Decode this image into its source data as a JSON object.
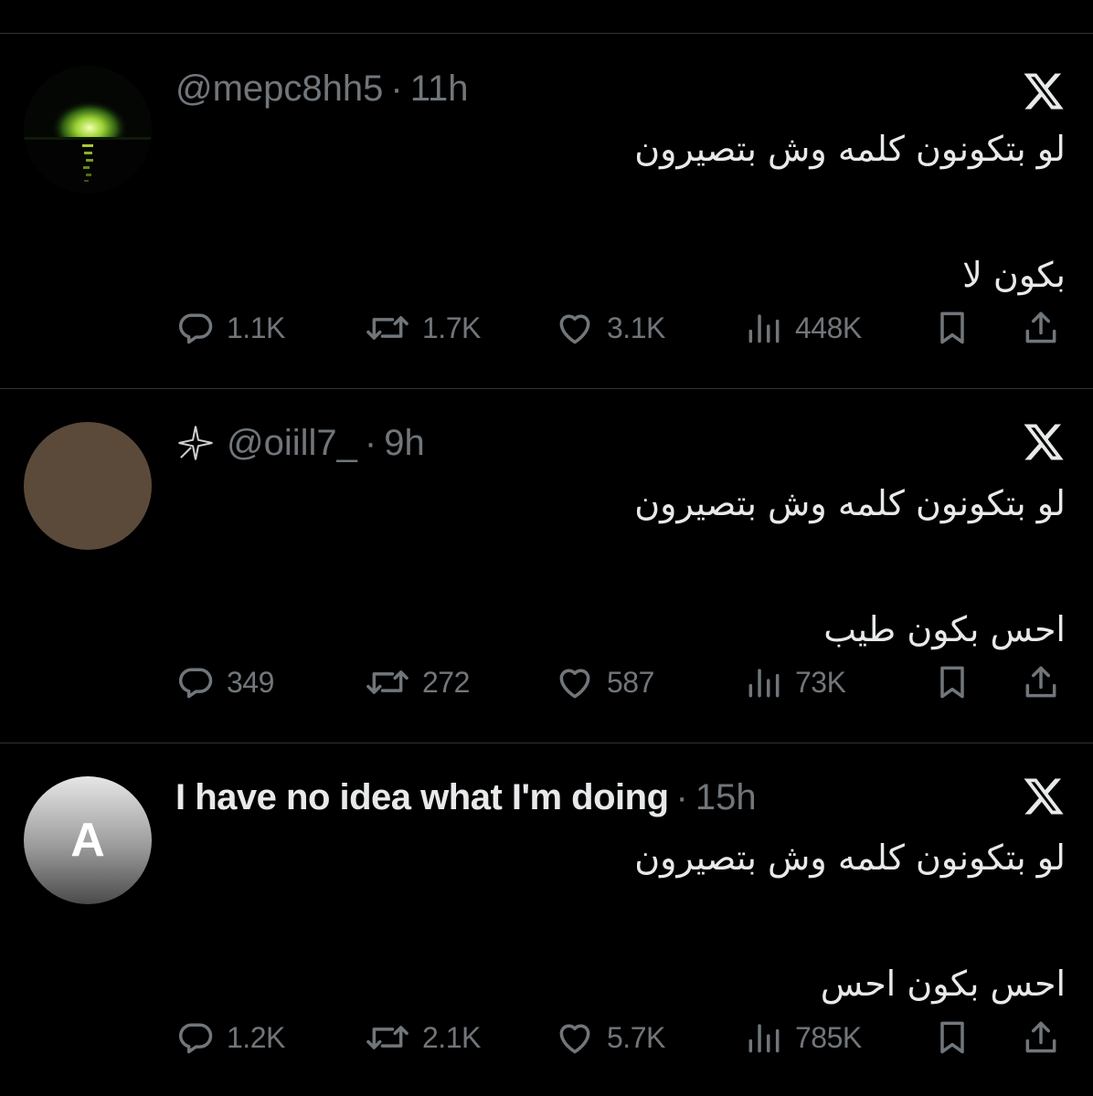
{
  "tweets": [
    {
      "name": "",
      "handle": "@mepc8hh5",
      "time": "11h",
      "avatar": "sea-night-icon",
      "text_line1": "لو بتكونون كلمه وش بتصيرون",
      "text_line2": "بكون لا",
      "replies": "1.1K",
      "reposts": "1.7K",
      "likes": "3.1K",
      "views": "448K"
    },
    {
      "name": "",
      "handle": "@oiill7_",
      "time": "9h",
      "avatar": "brown-circle",
      "text_line1": "لو بتكونون كلمه وش بتصيرون",
      "text_line2": "احس بكون طيب",
      "replies": "349",
      "reposts": "272",
      "likes": "587",
      "views": "73K"
    },
    {
      "name": "I have no idea what I'm doing",
      "handle": "",
      "time": "15h",
      "avatar_letter": "A",
      "text_line1": "لو بتكونون كلمه وش بتصيرون",
      "text_line2": "احس بكون احس",
      "replies": "1.2K",
      "reposts": "2.1K",
      "likes": "5.7K",
      "views": "785K"
    }
  ],
  "separator": "·",
  "colors": {
    "background": "#000000",
    "primary_text": "#e7e9ea",
    "secondary_text": "#71767b",
    "divider": "#2f3336"
  },
  "icons": [
    "reply-icon",
    "repost-icon",
    "like-icon",
    "views-icon",
    "bookmark-icon",
    "share-icon",
    "x-logo-icon",
    "star-icon"
  ]
}
